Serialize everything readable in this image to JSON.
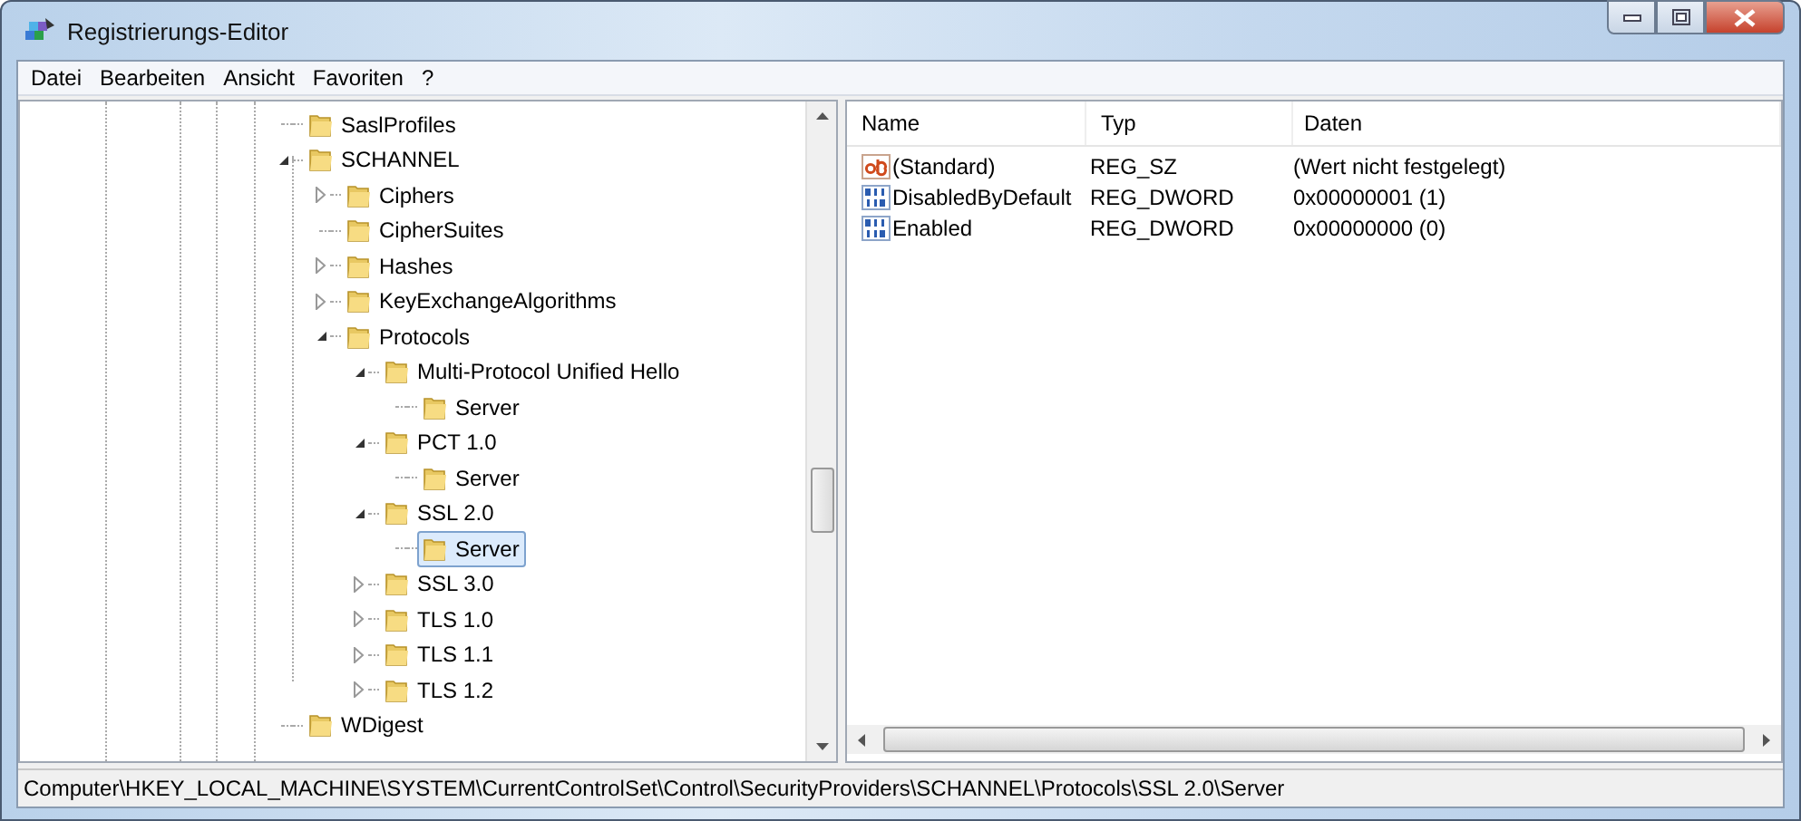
{
  "window": {
    "title": "Registrierungs-Editor"
  },
  "menu": [
    "Datei",
    "Bearbeiten",
    "Ansicht",
    "Favoriten",
    "?"
  ],
  "tree": {
    "items": [
      {
        "label": "SaslProfiles",
        "kind": "leaf",
        "selected": false
      },
      {
        "label": "SCHANNEL",
        "kind": "branch",
        "expanded": true,
        "selected": false,
        "children": [
          {
            "label": "Ciphers",
            "kind": "branch",
            "expanded": false,
            "selected": false
          },
          {
            "label": "CipherSuites",
            "kind": "leaf",
            "selected": false
          },
          {
            "label": "Hashes",
            "kind": "branch",
            "expanded": false,
            "selected": false
          },
          {
            "label": "KeyExchangeAlgorithms",
            "kind": "branch",
            "expanded": false,
            "selected": false
          },
          {
            "label": "Protocols",
            "kind": "branch",
            "expanded": true,
            "selected": false,
            "children": [
              {
                "label": "Multi-Protocol Unified Hello",
                "kind": "branch",
                "expanded": true,
                "selected": false,
                "children": [
                  {
                    "label": "Server",
                    "kind": "leaf",
                    "selected": false
                  }
                ]
              },
              {
                "label": "PCT 1.0",
                "kind": "branch",
                "expanded": true,
                "selected": false,
                "children": [
                  {
                    "label": "Server",
                    "kind": "leaf",
                    "selected": false
                  }
                ]
              },
              {
                "label": "SSL 2.0",
                "kind": "branch",
                "expanded": true,
                "selected": false,
                "children": [
                  {
                    "label": "Server",
                    "kind": "leaf",
                    "selected": true
                  }
                ]
              },
              {
                "label": "SSL 3.0",
                "kind": "branch",
                "expanded": false,
                "selected": false
              },
              {
                "label": "TLS 1.0",
                "kind": "branch",
                "expanded": false,
                "selected": false
              },
              {
                "label": "TLS 1.1",
                "kind": "branch",
                "expanded": false,
                "selected": false
              },
              {
                "label": "TLS 1.2",
                "kind": "branch",
                "expanded": false,
                "selected": false
              }
            ]
          }
        ]
      },
      {
        "label": "WDigest",
        "kind": "leaf",
        "selected": false
      }
    ]
  },
  "values": {
    "columns": [
      "Name",
      "Typ",
      "Daten"
    ],
    "rows": [
      {
        "kind": "string",
        "name": "(Standard)",
        "type": "REG_SZ",
        "data": "(Wert nicht festgelegt)"
      },
      {
        "kind": "binary",
        "name": "DisabledByDefault",
        "type": "REG_DWORD",
        "data": "0x00000001 (1)"
      },
      {
        "kind": "binary",
        "name": "Enabled",
        "type": "REG_DWORD",
        "data": "0x00000000 (0)"
      }
    ]
  },
  "status_bar": "Computer\\HKEY_LOCAL_MACHINE\\SYSTEM\\CurrentControlSet\\Control\\SecurityProviders\\SCHANNEL\\Protocols\\SSL 2.0\\Server"
}
